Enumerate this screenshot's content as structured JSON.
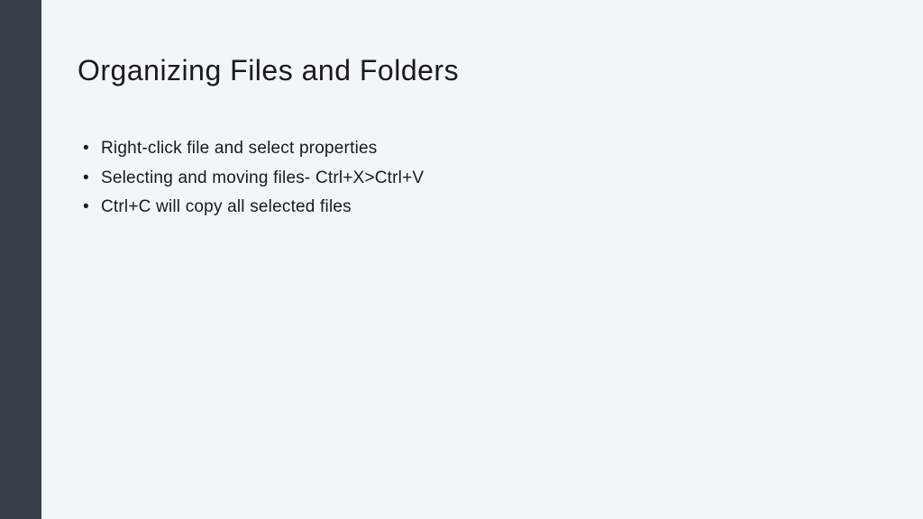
{
  "slide": {
    "title": "Organizing Files and Folders",
    "bullets": [
      "Right-click file and select properties",
      "Selecting and moving files- Ctrl+X>Ctrl+V",
      "Ctrl+C will copy all selected files"
    ]
  }
}
